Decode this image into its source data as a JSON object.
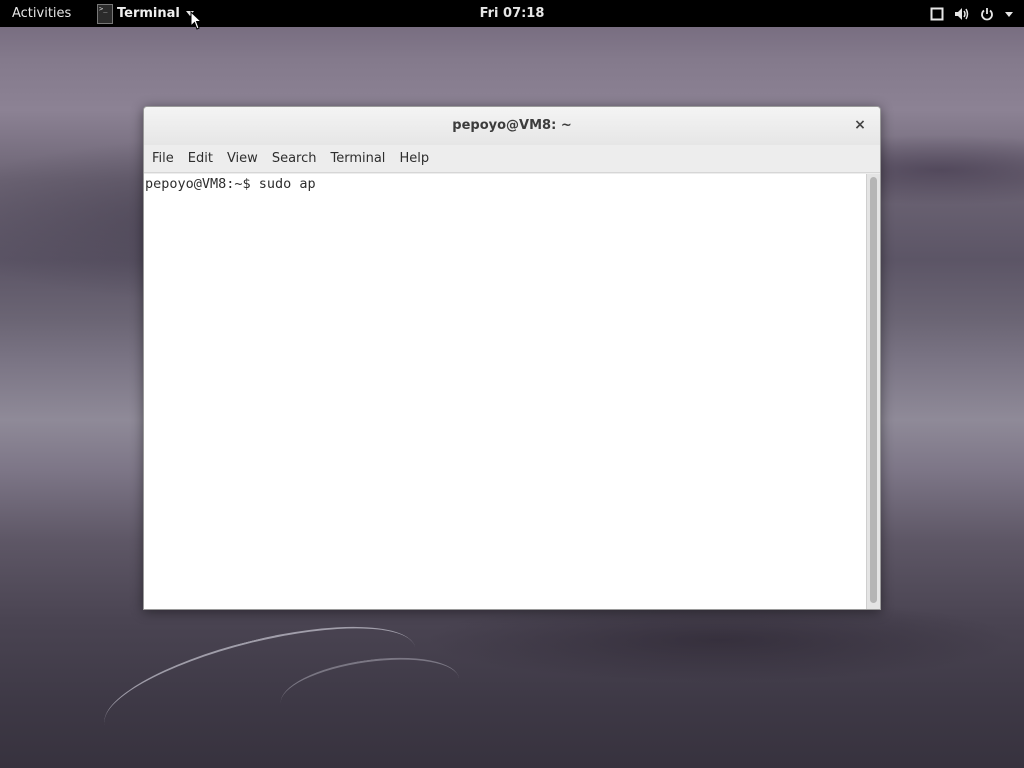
{
  "topbar": {
    "activities_label": "Activities",
    "app_menu_label": "Terminal",
    "app_icon_glyph": ">_",
    "clock": "Fri 07:18",
    "icons": [
      "window-icon",
      "volume-icon",
      "power-icon",
      "chevron-down-icon"
    ]
  },
  "window": {
    "title": "pepoyo@VM8: ~",
    "close_glyph": "×",
    "menu": [
      "File",
      "Edit",
      "View",
      "Search",
      "Terminal",
      "Help"
    ],
    "terminal_line": "pepoyo@VM8:~$ sudo ap"
  },
  "colors": {
    "topbar_bg": "#000000",
    "terminal_bg": "#ffffff",
    "window_chrome": "#ededed"
  }
}
